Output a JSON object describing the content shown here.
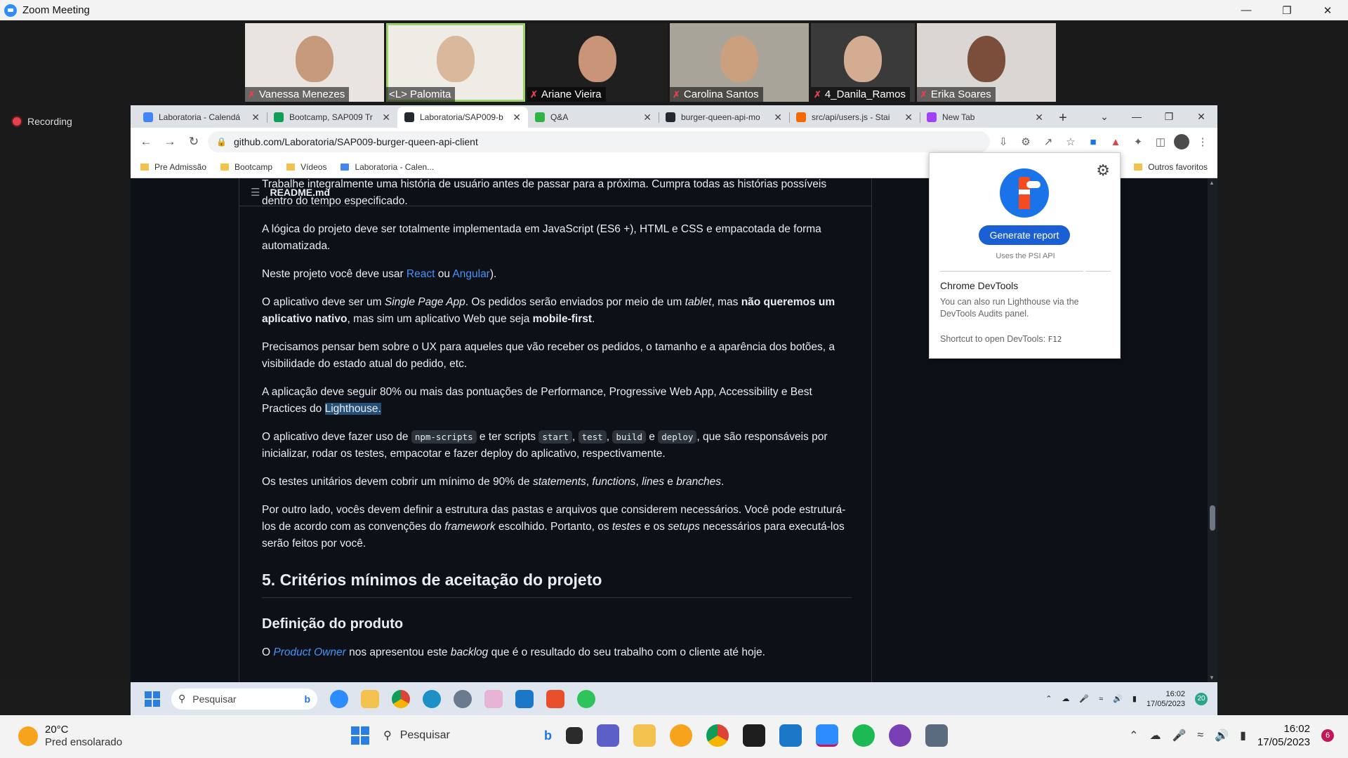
{
  "zoom": {
    "title": "Zoom Meeting",
    "recording_label": "Recording",
    "participants": [
      {
        "name": "Vanessa Menezes",
        "muted": true,
        "bg": "#e9e4df",
        "face": "#c89a7c"
      },
      {
        "name": "<L> Palomita",
        "muted": false,
        "active": true,
        "bg": "#efece6",
        "face": "#d9b89c"
      },
      {
        "name": "Ariane Vieira",
        "muted": true,
        "bg": "#1f1f1f",
        "face": "#c99478"
      },
      {
        "name": "Carolina Santos",
        "muted": true,
        "bg": "#a9a49a",
        "face": "#caa07e"
      },
      {
        "name": "4_Danila_Ramos",
        "muted": true,
        "bg": "#3b3a3b",
        "face": "#d3ac92"
      },
      {
        "name": "Erika Soares",
        "muted": true,
        "bg": "#d9d6d3",
        "face": "#7a4e3b"
      }
    ]
  },
  "chrome": {
    "tabs": [
      {
        "title": "Laboratoria - Calendá",
        "color": "#4285f4"
      },
      {
        "title": "Bootcamp, SAP009 Tr",
        "color": "#0f9d58"
      },
      {
        "title": "Laboratoria/SAP009-b",
        "color": "#24292f",
        "active": true
      },
      {
        "title": "Q&A",
        "color": "#2fb344"
      },
      {
        "title": "burger-queen-api-mo",
        "color": "#24292f"
      },
      {
        "title": "src/api/users.js - Stai",
        "color": "#f46800"
      },
      {
        "title": "New Tab",
        "color": "#a142f4"
      }
    ],
    "url": "github.com/Laboratoria/SAP009-burger-queen-api-client",
    "bookmarks": [
      "Pre Admissão",
      "Bootcamp",
      "Vídeos",
      "Laboratoria - Calen..."
    ],
    "bookmarks_other": "Outros favoritos"
  },
  "readme": {
    "header": "README.md",
    "p0": "Trabalhe integralmente uma história de usuário antes de passar para a próxima. Cumpra todas as histórias possíveis dentro do tempo especificado.",
    "p1": "A lógica do projeto deve ser totalmente implementada em JavaScript (ES6 +), HTML e CSS e empacotada de forma automatizada.",
    "p2_pre": "Neste projeto você deve usar ",
    "p2_react": "React",
    "p2_or": " ou ",
    "p2_angular": "Angular",
    "p2_post": ").",
    "p3_a": "O aplicativo deve ser um ",
    "p3_spa": "Single Page App",
    "p3_b": ". Os pedidos serão enviados por meio de um ",
    "p3_tablet": "tablet",
    "p3_c": ", mas ",
    "p3_strong1": "não queremos um aplicativo nativo",
    "p3_d": ", mas sim um aplicativo Web que seja ",
    "p3_strong2": "mobile-first",
    "p3_e": ".",
    "p4": "Precisamos pensar bem sobre o UX para aqueles que vão receber os pedidos, o tamanho e a aparência dos botões, a visibilidade do estado atual do pedido, etc.",
    "p5_a": "A aplicação deve seguir 80% ou mais das pontuações de Performance, Progressive Web App, Accessibility e Best Practices do ",
    "p5_hl": "Lighthouse.",
    "p6_a": "O aplicativo deve fazer uso de ",
    "p6_c1": "npm-scripts",
    "p6_b": " e ter scripts ",
    "p6_c2": "start",
    "p6_comma1": ", ",
    "p6_c3": "test",
    "p6_comma2": ", ",
    "p6_c4": "build",
    "p6_e": " e ",
    "p6_c5": "deploy",
    "p6_f": ", que são responsáveis por inicializar, rodar os testes, empacotar e fazer deploy do aplicativo, respectivamente.",
    "p7_a": "Os testes unitários devem cobrir um mínimo de 90% de ",
    "p7_i1": "statements",
    "p7_s1": ", ",
    "p7_i2": "functions",
    "p7_s2": ", ",
    "p7_i3": "lines",
    "p7_s3": " e ",
    "p7_i4": "branches",
    "p7_s4": ".",
    "p8_a": "Por outro lado, vocês devem definir a estrutura das pastas e arquivos que considerem necessários. Você pode estruturá-los de acordo com as convenções do ",
    "p8_i1": "framework",
    "p8_b": " escolhido. Portanto, os ",
    "p8_i2": "testes",
    "p8_c": " e os ",
    "p8_i3": "setups",
    "p8_d": " necessários para executá-los serão feitos por você.",
    "h2": "5. Critérios mínimos de aceitação do projeto",
    "h3": "Definição do produto",
    "p9_a": "O ",
    "p9_link": "Product Owner",
    "p9_b": " nos apresentou este ",
    "p9_i": "backlog",
    "p9_c": " que é o resultado do seu trabalho com o cliente até hoje."
  },
  "lighthouse": {
    "button": "Generate report",
    "psi": "Uses the PSI API",
    "devtools_title": "Chrome DevTools",
    "devtools_body": "You can also run Lighthouse via the DevTools Audits panel.",
    "shortcut_label": "Shortcut to open DevTools: ",
    "shortcut_key": "F12"
  },
  "inner_taskbar": {
    "search": "Pesquisar",
    "time": "16:02",
    "date": "17/05/2023",
    "badge": "20"
  },
  "outer_taskbar": {
    "temp": "20°C",
    "weather": "Pred ensolarado",
    "search": "Pesquisar",
    "time": "16:02",
    "date": "17/05/2023",
    "badge": "6"
  }
}
